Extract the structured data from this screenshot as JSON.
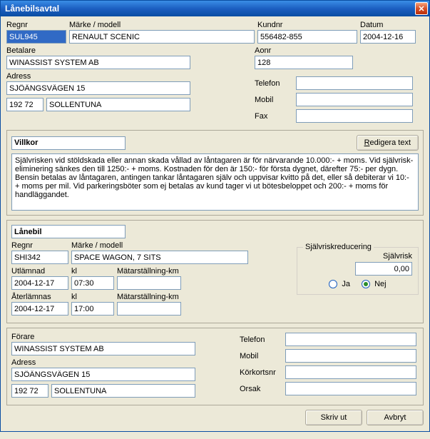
{
  "window": {
    "title": "Lånebilsavtal"
  },
  "top": {
    "regnr_label": "Regnr",
    "regnr": "SUL945",
    "marke_label": "Märke / modell",
    "marke": "RENAULT SCENIC",
    "kundnr_label": "Kundnr",
    "kundnr": "556482-855",
    "datum_label": "Datum",
    "datum": "2004-12-16",
    "betalare_label": "Betalare",
    "betalare": "WINASSIST SYSTEM AB",
    "aonr_label": "Aonr",
    "aonr": "128",
    "adress_label": "Adress",
    "adress": "SJÖÄNGSVÄGEN 15",
    "postnr": "192 72",
    "ort": "SOLLENTUNA",
    "telefon_label": "Telefon",
    "telefon": "",
    "mobil_label": "Mobil",
    "mobil": "",
    "fax_label": "Fax",
    "fax": ""
  },
  "villkor": {
    "title": "Villkor",
    "redigera_btn_prefix": "R",
    "redigera_btn_rest": "edigera text",
    "text": "Självrisken vid stöldskada eller annan skada vållad av låntagaren är för närvarande 10.000:- + moms. Vid självrisk-eliminering sänkes den till 1250:- + moms. Kostnaden för den är 150:- för första dygnet, därefter 75:- per dygn. Bensin betalas av låntagaren, antingen tankar låntagaren själv och uppvisar kvitto på det, eller så debiterar vi 10:- + moms per mil. Vid parkeringsböter som ej betalas av kund tager vi ut bötesbeloppet och 200:- + moms för handläggandet."
  },
  "lanebil": {
    "title": "Lånebil",
    "regnr_label": "Regnr",
    "regnr": "SHI342",
    "marke_label": "Märke / modell",
    "marke": "SPACE WAGON, 7 SITS",
    "utlamnad_label": "Utlämnad",
    "utlamnad_date": "2004-12-17",
    "utlamnad_kl_label": "kl",
    "utlamnad_kl": "07:30",
    "matarstallning_label": "Mätarställning-km",
    "matarstallning1": "",
    "aterlamnas_label": "Återlämnas",
    "aterlamnas_date": "2004-12-17",
    "aterlamnas_kl_label": "kl",
    "aterlamnas_kl": "17:00",
    "matarstallning2_label": "Mätarställning-km",
    "matarstallning2": "",
    "sjalvrisk_group": "Självriskreducering",
    "sjalvrisk_label": "Självrisk",
    "sjalvrisk_value": "0,00",
    "ja_label": "Ja",
    "nej_label": "Nej",
    "selected": "Nej"
  },
  "forare": {
    "forare_label": "Förare",
    "forare": "WINASSIST SYSTEM AB",
    "adress_label": "Adress",
    "adress": "SJÖÄNGSVÄGEN 15",
    "postnr": "192 72",
    "ort": "SOLLENTUNA",
    "telefon_label": "Telefon",
    "telefon": "",
    "mobil_label": "Mobil",
    "mobil": "",
    "korkortsnr_label": "Körkortsnr",
    "korkortsnr": "",
    "orsak_label": "Orsak",
    "orsak": ""
  },
  "footer": {
    "skrivut": "Skriv ut",
    "avbryt": "Avbryt"
  }
}
